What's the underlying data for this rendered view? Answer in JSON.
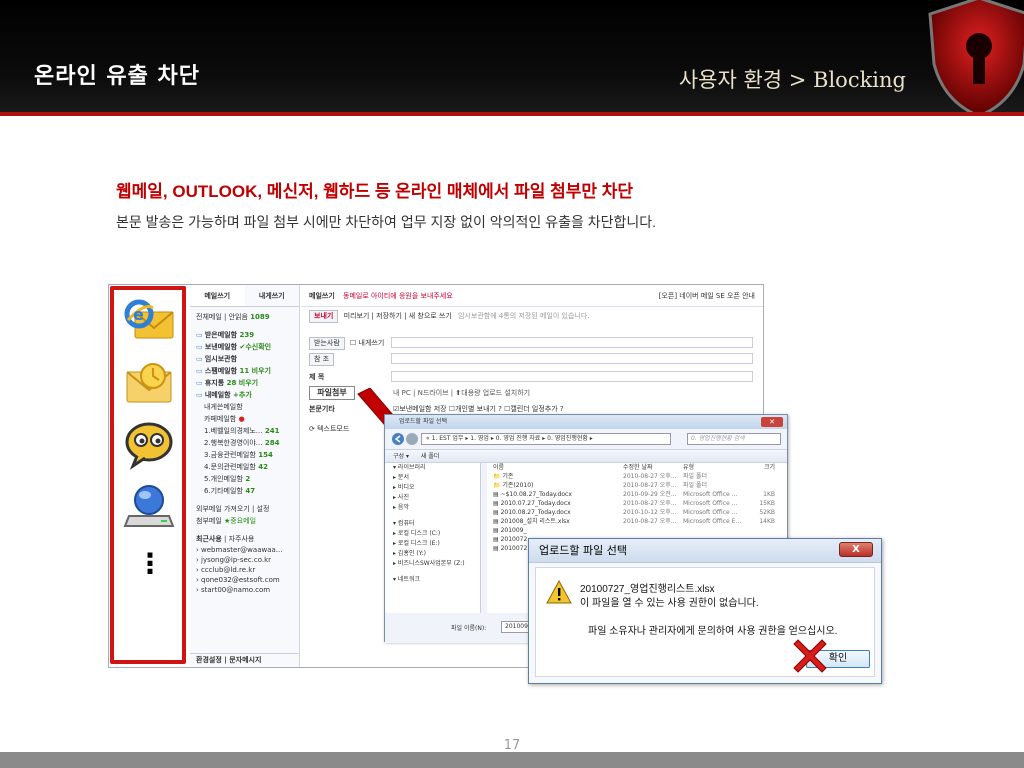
{
  "header": {
    "title": "온라인 유출 차단",
    "subtitle": "사용자 환경 > Blocking"
  },
  "headline": "웹메일, OUTLOOK, 메신저, 웹하드 등 온라인 매체에서 파일 첨부만 차단",
  "description": "본문 발송은 가능하며 파일 첨부 시에만 차단하여 업무 지장 없이 악의적인 유출을 차단합니다.",
  "apps": {
    "icons": [
      "ie-mail-icon",
      "outlook-icon",
      "messenger-icon",
      "webhard-icon"
    ],
    "more": "⋮"
  },
  "mail": {
    "tab_write": "메일쓰기",
    "tab_contacts": "내게쓰기",
    "all_mail": "전체메일",
    "unread_label": "안읽음",
    "unread_count": "1089",
    "folders": [
      {
        "label": "받은메일함",
        "count": "239"
      },
      {
        "label": "보낸메일함",
        "count": "✔수신확인"
      },
      {
        "label": "임시보관함",
        "count": ""
      },
      {
        "label": "스팸메일함",
        "count": "11 비우기"
      },
      {
        "label": "휴지통",
        "count": "28 비우기"
      },
      {
        "label": "내메일함",
        "count": "+추가"
      }
    ],
    "sub_folders": [
      {
        "label": "내게쓴메일함",
        "count": ""
      },
      {
        "label": "카페메일함",
        "count": "●"
      },
      {
        "label": "1.베벨일의경제노...",
        "count": "241"
      },
      {
        "label": "2.행복한경영이야...",
        "count": "284"
      },
      {
        "label": "3.금융관련메일함",
        "count": "154"
      },
      {
        "label": "4.문의관련메일함",
        "count": "42"
      },
      {
        "label": "5.개인메일함",
        "count": "2"
      },
      {
        "label": "6.기타메일함",
        "count": "47"
      }
    ],
    "external": "외부메일 가져오기 | 설정",
    "attach_label": "첨부메일",
    "important_label": "★중요메일",
    "recent_label": "최근사용",
    "frequent_label": "자주사용",
    "recent_addresses": [
      "webmaster@waawaa...",
      "jysong@ip-sec.co.kr",
      "ccclub@ld.re.kr",
      "qone032@estsoft.com",
      "start00@namo.com"
    ],
    "settings": "환경설정",
    "sms": "문자메시지",
    "compose_title": "메일쓰기",
    "compose_notice": "동메일로 아이티에 응원을 보내주세요",
    "compose_right": "[오픈] 네이버 메일 SE 오픈 안내",
    "toolbar": [
      "보내기",
      "미리보기",
      "저장하기",
      "새 창으로 쓰기"
    ],
    "toolbar_note": "임시보관함에 4통의 저장된 메일이 있습니다.",
    "to_label": "받는사람",
    "to_self": "내게쓰기",
    "cc_label": "참 조",
    "subject_label": "제 목",
    "attach_field": "파일첨부",
    "attach_opts": "내 PC | N드라이브 | ⬆대용량 업로드 설치하기",
    "body_label": "본문기타",
    "body_opts": "☑보낸메일함 저장 ☐개인별 보내기 ? ☐캘린더 일정추가 ?",
    "text_mode": "텍스트모드"
  },
  "explorer": {
    "title": "업로드할 파일 선택",
    "path": "« 1. EST 업무 ▸ 1. 영업 ▸ 0. 영업 진행 자료 ▸ 0. 영업진행현황 ▸",
    "search": "0. 영업진행현황 검색",
    "tool_org": "구성 ▾",
    "tool_new": "새 폴더",
    "tree": [
      "라이브러리",
      "문서",
      "비디오",
      "사진",
      "음악",
      "",
      "컴퓨터",
      "로컬 디스크 (C:)",
      "로컬 디스크 (E:)",
      "김홍인 (Y:)",
      "비즈니스SW사업본부 (Z:)",
      "",
      "네트워크"
    ],
    "columns": {
      "name": "이름",
      "date": "수정한 날짜",
      "type": "유형",
      "size": "크기"
    },
    "files": [
      {
        "name": "기존",
        "date": "2010-08-27 오후...",
        "type": "파일 폴더",
        "size": ""
      },
      {
        "name": "기존(2010)",
        "date": "2010-08-27 오후...",
        "type": "파일 폴더",
        "size": ""
      },
      {
        "name": "~$10.08.27_Today.docx",
        "date": "2010-09-29 오전...",
        "type": "Microsoft Office ...",
        "size": "1KB"
      },
      {
        "name": "2010.07.27_Today.docx",
        "date": "2010-08-27 오후...",
        "type": "Microsoft Office ...",
        "size": "15KB"
      },
      {
        "name": "2010.08.27_Today.docx",
        "date": "2010-10-12 오후...",
        "type": "Microsoft Office ...",
        "size": "52KB"
      },
      {
        "name": "201008_설치 리스트.xlsx",
        "date": "2010-08-27 오후...",
        "type": "Microsoft Office E...",
        "size": "14KB"
      },
      {
        "name": "201009_",
        "date": "",
        "type": "",
        "size": ""
      },
      {
        "name": "2010072",
        "date": "",
        "type": "",
        "size": ""
      },
      {
        "name": "2010072",
        "date": "",
        "type": "",
        "size": ""
      }
    ],
    "filename_label": "파일 이름(N):",
    "filename_value": "201009_설치"
  },
  "dialog": {
    "title": "업로드할 파일 선택",
    "close": "X",
    "line1": "20100727_영업진행리스트.xlsx",
    "line2": "이 파일을 열 수 있는 사용 권한이 없습니다.",
    "line3": "파일 소유자나 관리자에게 문의하여 사용 권한을 얻으십시오.",
    "ok": "확인"
  },
  "page_number": "17"
}
